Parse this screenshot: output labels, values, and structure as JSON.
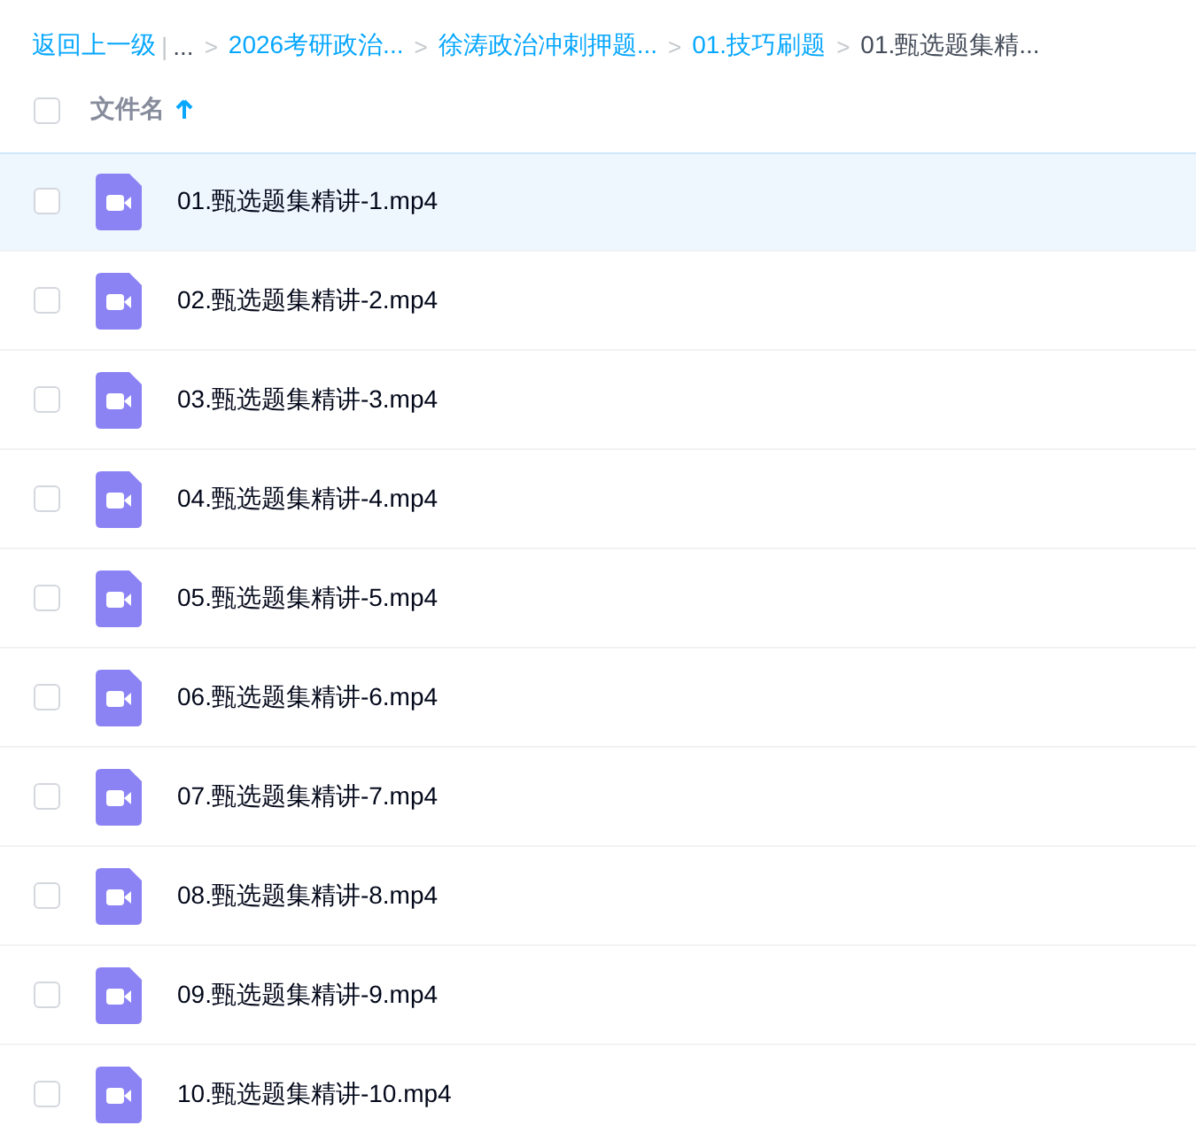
{
  "breadcrumb": [
    {
      "kind": "link",
      "text": "返回上一级"
    },
    {
      "kind": "divider",
      "text": "|"
    },
    {
      "kind": "ellipsis",
      "text": "..."
    },
    {
      "kind": "separator",
      "text": ">"
    },
    {
      "kind": "link",
      "text": "2026考研政治..."
    },
    {
      "kind": "separator",
      "text": ">"
    },
    {
      "kind": "link",
      "text": "徐涛政治冲刺押题..."
    },
    {
      "kind": "separator",
      "text": ">"
    },
    {
      "kind": "link",
      "text": "01.技巧刷题"
    },
    {
      "kind": "separator",
      "text": ">"
    },
    {
      "kind": "current",
      "text": "01.甄选题集精..."
    }
  ],
  "header": {
    "checked": false,
    "column": "文件名",
    "sort_ascending": true
  },
  "files": [
    {
      "name": "01.甄选题集精讲-1.mp4",
      "checked": false,
      "highlighted": true
    },
    {
      "name": "02.甄选题集精讲-2.mp4",
      "checked": false,
      "highlighted": false
    },
    {
      "name": "03.甄选题集精讲-3.mp4",
      "checked": false,
      "highlighted": false
    },
    {
      "name": "04.甄选题集精讲-4.mp4",
      "checked": false,
      "highlighted": false
    },
    {
      "name": "05.甄选题集精讲-5.mp4",
      "checked": false,
      "highlighted": false
    },
    {
      "name": "06.甄选题集精讲-6.mp4",
      "checked": false,
      "highlighted": false
    },
    {
      "name": "07.甄选题集精讲-7.mp4",
      "checked": false,
      "highlighted": false
    },
    {
      "name": "08.甄选题集精讲-8.mp4",
      "checked": false,
      "highlighted": false
    },
    {
      "name": "09.甄选题集精讲-9.mp4",
      "checked": false,
      "highlighted": false
    },
    {
      "name": "10.甄选题集精讲-10.mp4",
      "checked": false,
      "highlighted": false
    }
  ]
}
